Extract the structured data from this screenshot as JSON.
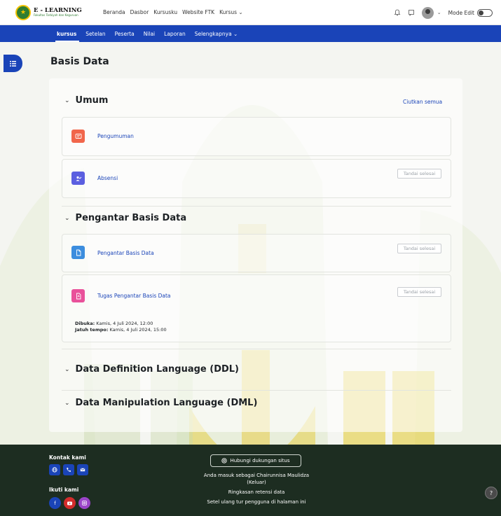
{
  "brand": {
    "title": "E - LEARNING",
    "subtitle": "Fakultas Tarbiyah dan Keguruan"
  },
  "topnav": {
    "items": [
      "Beranda",
      "Dasbor",
      "Kursusku",
      "Website FTK",
      "Kursus ⌄"
    ]
  },
  "topright": {
    "mode_label": "Mode Edit",
    "notification_icon": "bell-icon",
    "message_icon": "chat-icon"
  },
  "secnav": {
    "items": [
      "kursus",
      "Setelan",
      "Peserta",
      "Nilai",
      "Laporan",
      "Selengkapnya ⌄"
    ]
  },
  "page": {
    "title": "Basis Data",
    "collapse_all": "Ciutkan semua"
  },
  "sections": [
    {
      "title": "Umum",
      "activities": [
        {
          "name": "Pengumuman",
          "icon": "forum-icon",
          "color": "#f1664b"
        },
        {
          "name": "Absensi",
          "icon": "attendance-icon",
          "color": "#5b5fe0",
          "mark": "Tandai selesai"
        }
      ]
    },
    {
      "title": "Pengantar Basis Data",
      "activities": [
        {
          "name": "Pengantar Basis Data",
          "icon": "file-icon",
          "color": "#3c8dde",
          "mark": "Tandai selesai"
        },
        {
          "name": "Tugas Pengantar Basis Data",
          "icon": "assignment-icon",
          "color": "#e9519a",
          "mark": "Tandai selesai",
          "opened_label": "Dibuka:",
          "opened": "Kamis, 4 Juli 2024, 12:00",
          "due_label": "Jatuh tempo:",
          "due": "Kamis, 4 Juli 2024, 15:00"
        }
      ]
    },
    {
      "title": "Data Definition Language (DDL)"
    },
    {
      "title": "Data Manipulation Language (DML)"
    }
  ],
  "footer": {
    "contact_title": "Kontak kami",
    "follow_title": "Ikuti kami",
    "support_button": "Hubungi dukungan situs",
    "logged_in": "Anda masuk sebagai Chairunnisa Maulidza",
    "logout": "(Keluar)",
    "data_retention": "Ringkasan retensi data",
    "reset_tour": "Setel ulang tur pengguna di halaman ini",
    "help": "?"
  },
  "colors": {
    "primary": "#1a44b8",
    "footer": "#1d2d21",
    "youtube": "#d32c2c",
    "instagram": "#9b45c9"
  }
}
